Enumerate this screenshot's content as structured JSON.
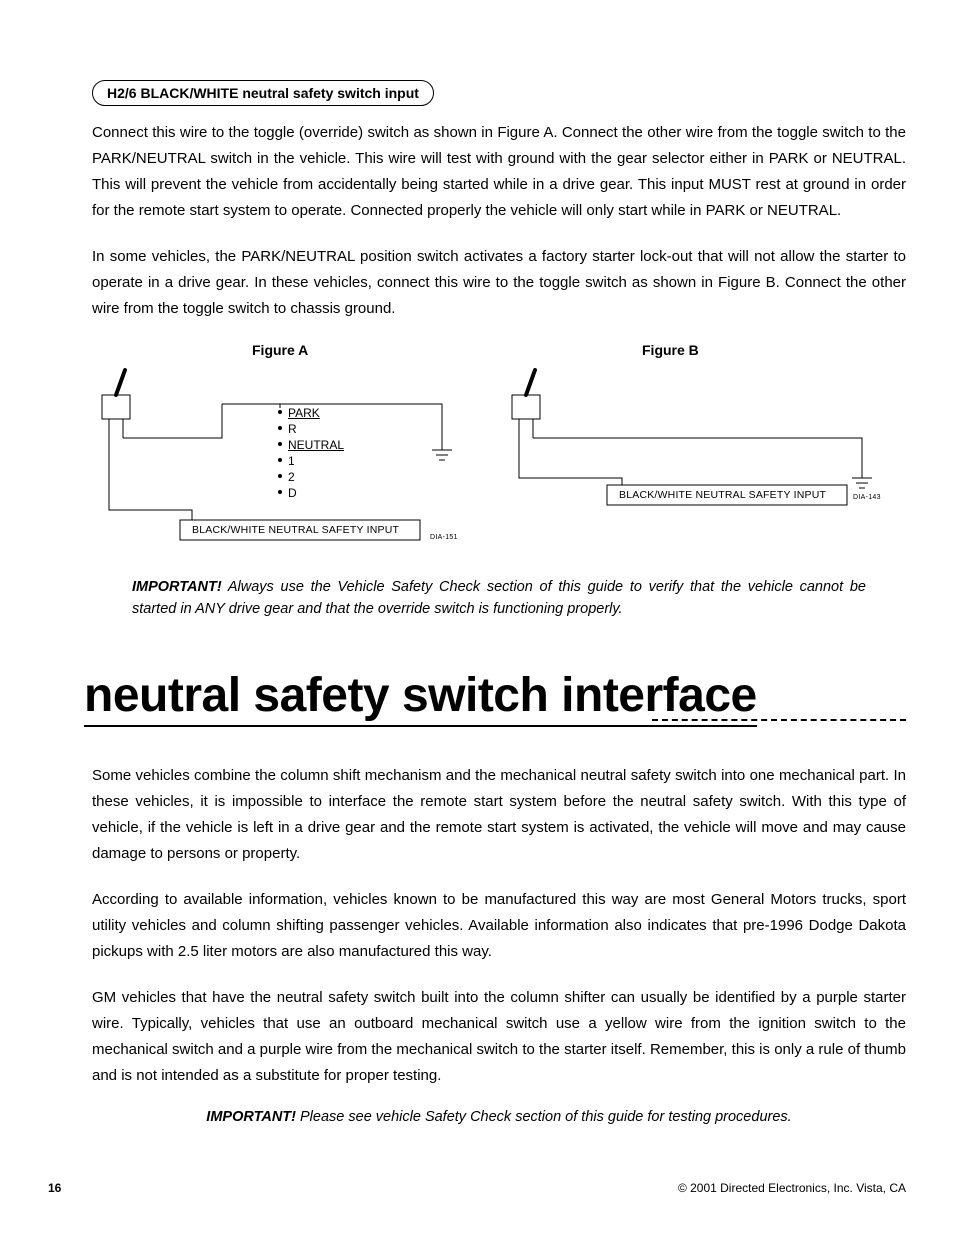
{
  "pill_label": "H2/6 BLACK/WHITE neutral safety switch input",
  "para1": "Connect this wire to the toggle (override) switch as shown in Figure A. Connect the other wire from the toggle switch to the PARK/NEUTRAL switch in the vehicle. This wire will test with ground with the gear selector either in PARK or NEUTRAL. This will prevent the vehicle from accidentally being started while in a drive gear. This input MUST rest at ground in order for the remote start system to operate. Connected properly the vehicle will only start while in PARK or NEUTRAL.",
  "para2": "In some vehicles, the PARK/NEUTRAL position switch activates a factory starter lock-out that will not allow the starter to operate in a drive gear. In these vehicles, connect this wire to the toggle switch as shown in Figure B. Connect the other wire from the toggle switch to chassis ground.",
  "figA": {
    "caption": "Figure A",
    "gears": [
      "PARK",
      "R",
      "NEUTRAL",
      "1",
      "2",
      "D"
    ],
    "input_label": "BLACK/WHITE NEUTRAL SAFETY INPUT",
    "code": "DIA-151"
  },
  "figB": {
    "caption": "Figure B",
    "input_label": "BLACK/WHITE NEUTRAL SAFETY INPUT",
    "code": "DIA-143"
  },
  "important1_lead": "IMPORTANT!",
  "important1_body": " Always use the Vehicle Safety Check section of this guide to verify that the vehicle cannot be started in ANY drive gear and that the override switch is functioning properly.",
  "heading": "neutral safety switch interface",
  "para3": "Some vehicles combine the column shift mechanism and the mechanical neutral safety switch into one mechanical part. In these vehicles, it is impossible to interface the remote start system before the neutral safety switch. With this type of vehicle, if the vehicle is left in a drive gear and the remote start system is activated, the vehicle will move and may cause damage to persons or property.",
  "para4": "According to available information, vehicles known to be manufactured this way are most General Motors trucks, sport utility vehicles and column shifting passenger vehicles. Available information also indicates that pre-1996 Dodge Dakota pickups with 2.5 liter motors are also manufactured this way.",
  "para5": "GM vehicles that have the neutral safety switch built into the column shifter can usually be identified by a purple starter wire. Typically, vehicles that use an outboard mechanical switch use a yellow wire from the ignition switch to the mechanical switch and a purple wire from the mechanical switch to the starter itself. Remember, this is only a rule of thumb and is not intended as a substitute for proper testing.",
  "important2_lead": "IMPORTANT!",
  "important2_body": " Please see vehicle Safety Check section of this guide for testing procedures.",
  "page_number": "16",
  "copyright": "© 2001 Directed Electronics, Inc. Vista, CA"
}
